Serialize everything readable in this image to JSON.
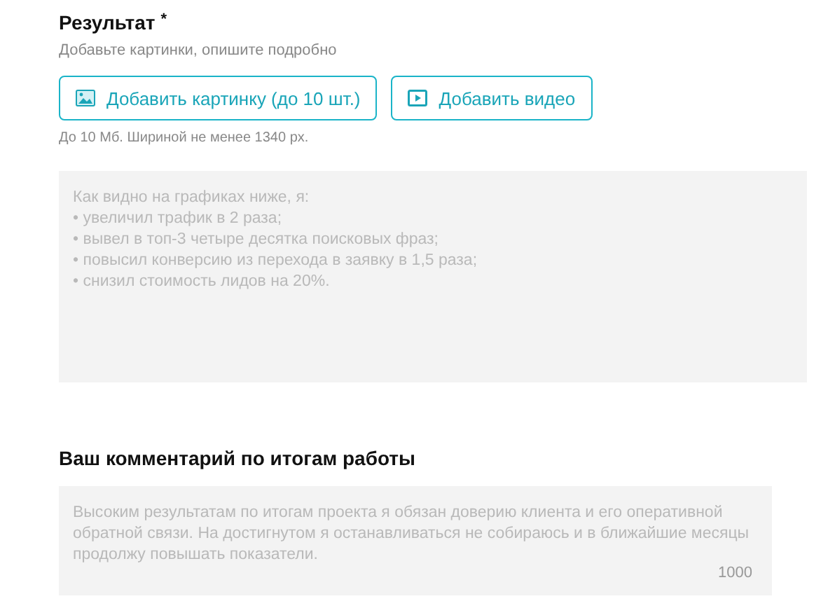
{
  "result": {
    "title": "Результат",
    "required_mark": "*",
    "hint": "Добавьте картинки, опишите подробно",
    "buttons": [
      {
        "label": "Добавить картинку (до 10 шт.)",
        "kind": "image"
      },
      {
        "label": "Добавить видео",
        "kind": "video"
      }
    ],
    "note": "До 10 Мб. Шириной не менее 1340 px.",
    "field": {
      "placeholder": "Как видно на графиках ниже, я:\n• увеличил трафик в 2 раза;\n• вывел в топ-3 четыре десятка поисковых фраз;\n• повысил конверсию из перехода в заявку в 1,5 раза;\n• снизил стоимость лидов на 20%."
    }
  },
  "comment": {
    "title": "Ваш комментарий по итогам работы",
    "field": {
      "placeholder": "Высоким результатам по итогам проекта я обязан доверию клиента и его оперативной обратной связи. На достигнутом я останавливаться не собираюсь и в ближайшие месяцы продолжу повышать показатели.",
      "counter": "1000"
    }
  }
}
